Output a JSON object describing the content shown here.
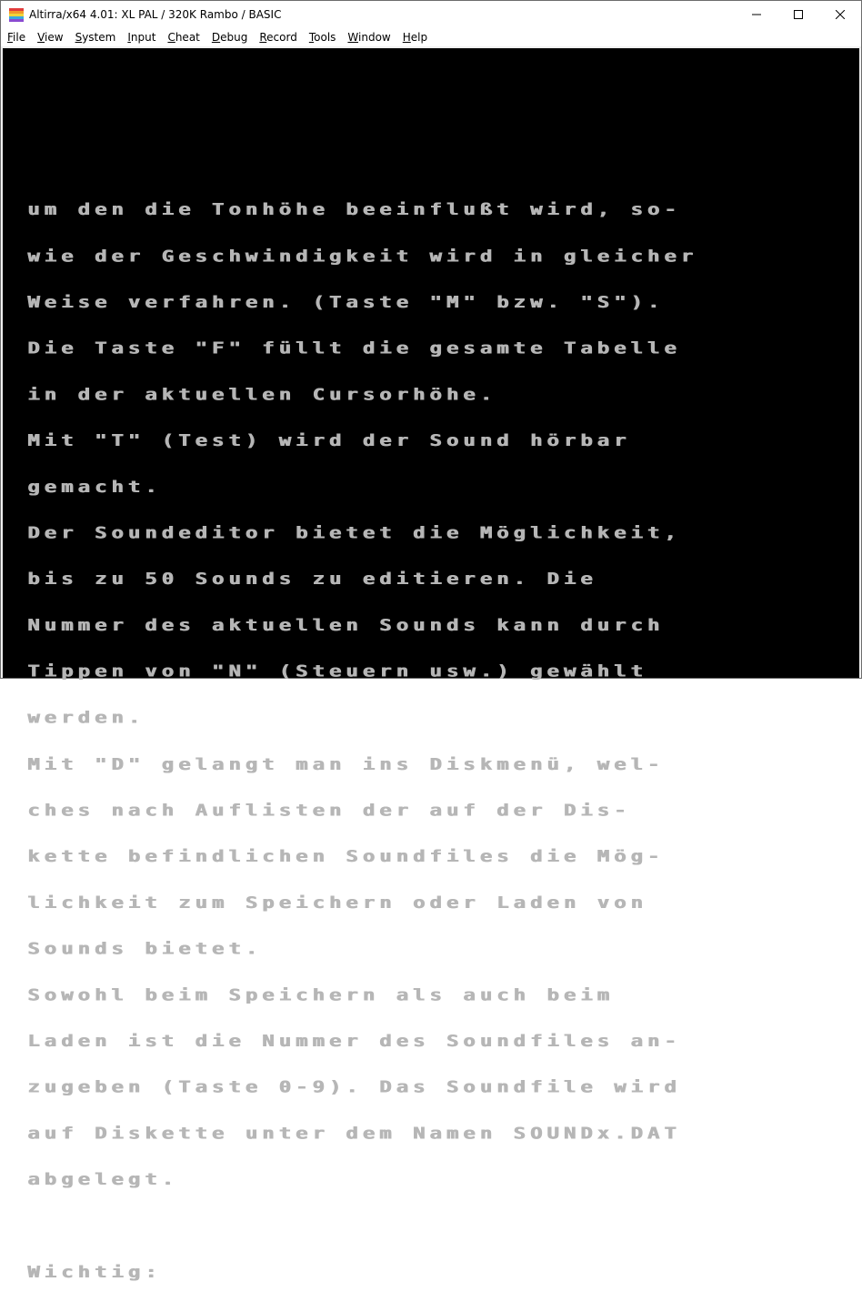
{
  "window": {
    "title": "Altirra/x64 4.01: XL PAL / 320K Rambo / BASIC",
    "icon": "altirra-rainbow-icon",
    "controls": {
      "minimize_icon": "minimize-icon",
      "maximize_icon": "maximize-icon",
      "close_icon": "close-icon"
    }
  },
  "menubar": {
    "items": [
      {
        "accel": "F",
        "rest": "ile"
      },
      {
        "accel": "V",
        "rest": "iew"
      },
      {
        "accel": "S",
        "rest": "ystem"
      },
      {
        "accel": "I",
        "rest": "nput"
      },
      {
        "accel": "C",
        "rest": "heat"
      },
      {
        "accel": "D",
        "rest": "ebug"
      },
      {
        "accel": "R",
        "rest": "ecord"
      },
      {
        "accel": "T",
        "rest": "ools"
      },
      {
        "accel": "W",
        "rest": "indow"
      },
      {
        "accel": "H",
        "rest": "elp"
      }
    ]
  },
  "screen": {
    "background": "#000000",
    "text_color": "#b6b6b6",
    "lines": [
      "um den die Tonhöhe beeinflußt wird, so-",
      "wie der Geschwindigkeit wird in gleicher",
      "Weise verfahren. (Taste \"M\" bzw. \"S\").",
      "Die Taste \"F\" füllt die gesamte Tabelle",
      "in der aktuellen Cursorhöhe.",
      "Mit \"T\" (Test) wird der Sound hörbar",
      "gemacht.",
      "Der Soundeditor bietet die Möglichkeit,",
      "bis zu 50 Sounds zu editieren. Die",
      "Nummer des aktuellen Sounds kann durch",
      "Tippen von \"N\" (Steuern usw.) gewählt",
      "werden.",
      "Mit \"D\" gelangt man ins Diskmenü, wel-",
      "ches nach Auflisten der auf der Dis-",
      "kette befindlichen Soundfiles die Mög-",
      "lichkeit zum Speichern oder Laden von",
      "Sounds bietet.",
      "Sowohl beim Speichern als auch beim",
      "Laden ist die Nummer des Soundfiles an-",
      "zugeben (Taste 0-9). Das Soundfile wird",
      "auf Diskette unter dem Namen SOUNDx.DAT",
      "abgelegt.",
      "",
      "Wichtig:"
    ]
  }
}
